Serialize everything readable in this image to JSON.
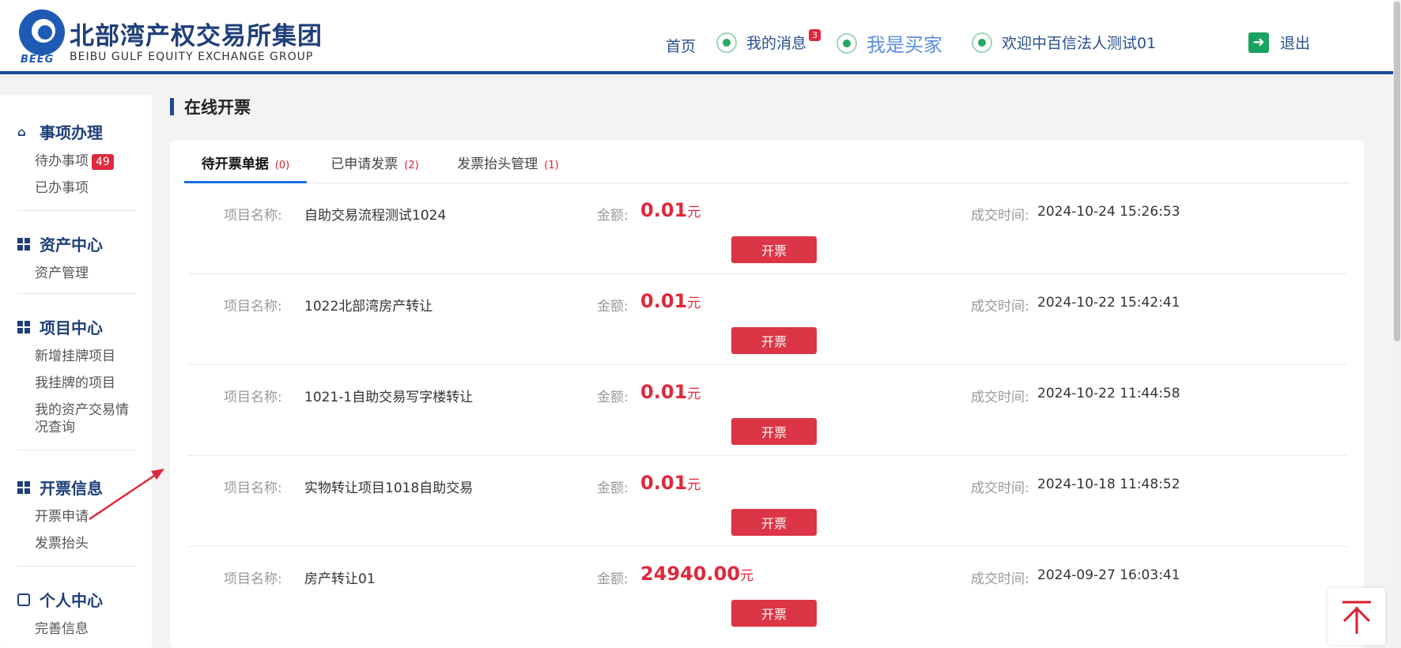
{
  "header": {
    "logo_abbr": "BEEG",
    "logo_cn": "北部湾产权交易所集团",
    "logo_en": "BEIBU GULF EQUITY EXCHANGE GROUP",
    "nav_home": "首页",
    "nav_messages": "我的消息",
    "messages_count": "3",
    "nav_buyer": "我是买家",
    "nav_welcome": "欢迎中百信法人测试01",
    "nav_logout": "退出",
    "icons": [
      "bell-icon",
      "user-icon",
      "user-icon",
      "logout-icon"
    ]
  },
  "sidebar": {
    "sections": [
      {
        "title": "事项办理",
        "icon": "home-icon",
        "links": [
          {
            "label": "待办事项",
            "badge": "49"
          },
          {
            "label": "已办事项"
          }
        ]
      },
      {
        "title": "资产中心",
        "icon": "grid-icon",
        "links": [
          {
            "label": "资产管理"
          }
        ]
      },
      {
        "title": "项目中心",
        "icon": "grid-icon",
        "links": [
          {
            "label": "新增挂牌项目"
          },
          {
            "label": "我挂牌的项目"
          },
          {
            "label": "我的资产交易情况查询"
          }
        ]
      },
      {
        "title": "开票信息",
        "icon": "grid-icon",
        "links": [
          {
            "label": "开票申请"
          },
          {
            "label": "发票抬头"
          }
        ]
      },
      {
        "title": "个人中心",
        "icon": "user-card-icon",
        "links": [
          {
            "label": "完善信息"
          }
        ]
      }
    ]
  },
  "main": {
    "heading": "在线开票",
    "tabs": [
      {
        "label": "待开票单据",
        "count": "(0)",
        "active": true
      },
      {
        "label": "已申请发票",
        "count": "(2)",
        "active": false
      },
      {
        "label": "发票抬头管理",
        "count": "(1)",
        "active": false
      }
    ],
    "field_labels": {
      "name": "项目名称:",
      "amount": "金额:",
      "time": "成交时间:"
    },
    "amount_unit": "元",
    "button_label": "开票",
    "rows": [
      {
        "name": "自助交易流程测试1024",
        "amount": "0.01",
        "time": "2024-10-24 15:26:53"
      },
      {
        "name": "1022北部湾房产转让",
        "amount": "0.01",
        "time": "2024-10-22 15:42:41"
      },
      {
        "name": "1021-1自助交易写字楼转让",
        "amount": "0.01",
        "time": "2024-10-22 11:44:58"
      },
      {
        "name": "实物转让项目1018自助交易",
        "amount": "0.01",
        "time": "2024-10-18 11:48:52"
      },
      {
        "name": "房产转让01",
        "amount": "24940.00",
        "time": "2024-09-27 16:03:41"
      }
    ]
  },
  "colors": {
    "brand": "#1f3f7a",
    "accent_red": "#dc3545",
    "tab_active": "#1f6fe0"
  }
}
